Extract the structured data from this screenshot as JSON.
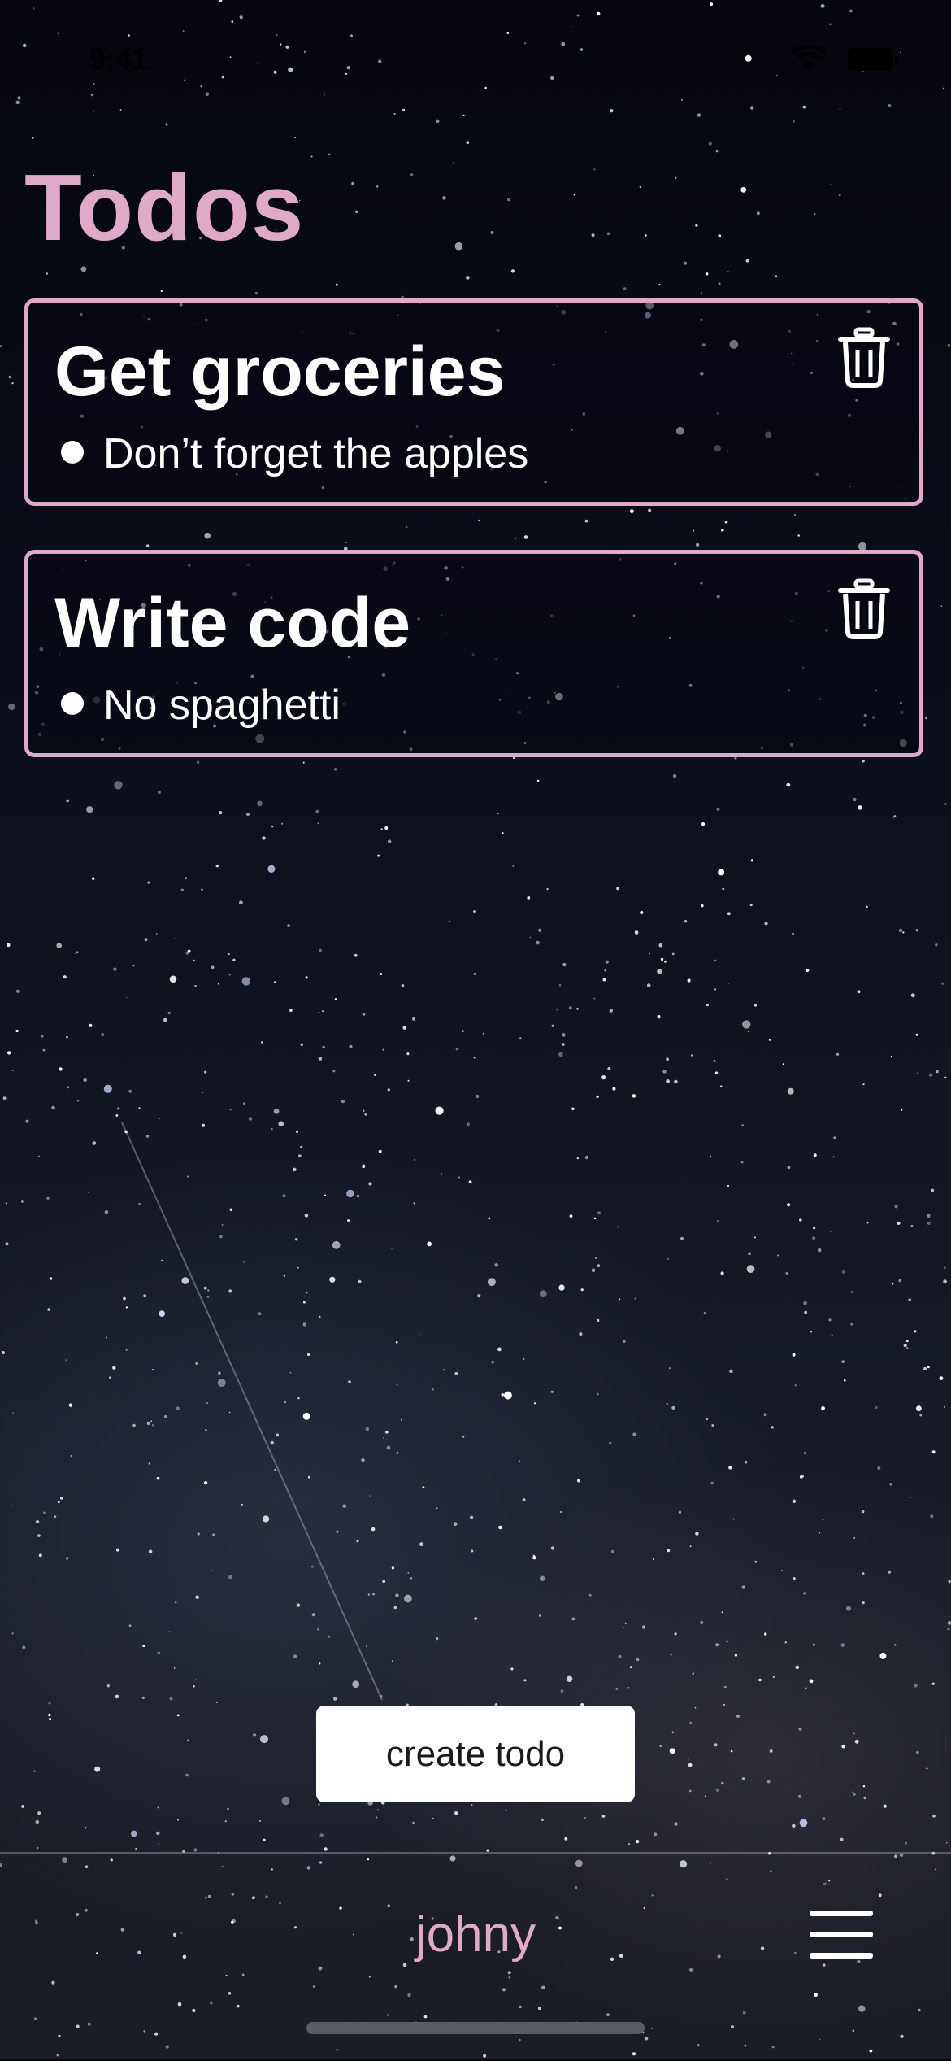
{
  "status_bar": {
    "time": "9:41"
  },
  "page": {
    "title": "Todos"
  },
  "todos": [
    {
      "title": "Get groceries",
      "note": "Don’t forget the apples"
    },
    {
      "title": "Write code",
      "note": "No spaghetti"
    }
  ],
  "actions": {
    "create_label": "create todo"
  },
  "bottom_bar": {
    "username": "johny"
  },
  "icons": {
    "delete": "trash-icon",
    "menu": "hamburger-menu-icon",
    "bullet": "bullet-icon"
  },
  "colors": {
    "accent": "#deaac8",
    "text": "#ffffff",
    "button_bg": "#ffffff"
  }
}
